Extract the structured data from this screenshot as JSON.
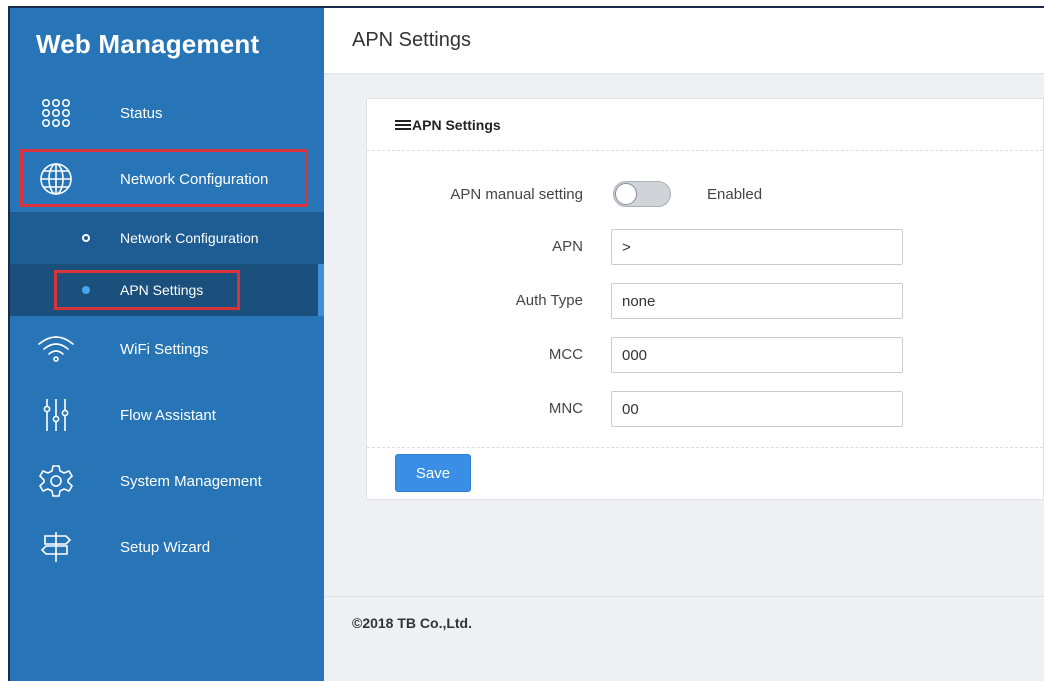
{
  "app": {
    "title": "Web Management"
  },
  "header": {
    "title": "APN Settings"
  },
  "sidebar": {
    "items": [
      {
        "label": "Status",
        "icon": "grid-dots-icon"
      },
      {
        "label": "Network Configuration",
        "icon": "globe-icon"
      },
      {
        "label": "WiFi Settings",
        "icon": "wifi-icon"
      },
      {
        "label": "Flow Assistant",
        "icon": "sliders-icon"
      },
      {
        "label": "System Management",
        "icon": "gear-icon"
      },
      {
        "label": "Setup Wizard",
        "icon": "signpost-icon"
      }
    ],
    "subitems": [
      {
        "label": "Network Configuration"
      },
      {
        "label": "APN Settings"
      }
    ]
  },
  "panel": {
    "title": "APN Settings",
    "apn_manual_label": "APN manual setting",
    "apn_manual_state": "Enabled",
    "fields": {
      "apn": {
        "label": "APN",
        "value": ">"
      },
      "auth_type": {
        "label": "Auth Type",
        "value": "none"
      },
      "mcc": {
        "label": "MCC",
        "value": "000"
      },
      "mnc": {
        "label": "MNC",
        "value": "00"
      }
    },
    "save_label": "Save"
  },
  "footer": {
    "copyright": "©2018 TB Co.,Ltd."
  },
  "colors": {
    "sidebar": "#2775b6",
    "submenu": "#1d5d93",
    "highlight": "#d8323b",
    "button": "#3b8ee6"
  }
}
